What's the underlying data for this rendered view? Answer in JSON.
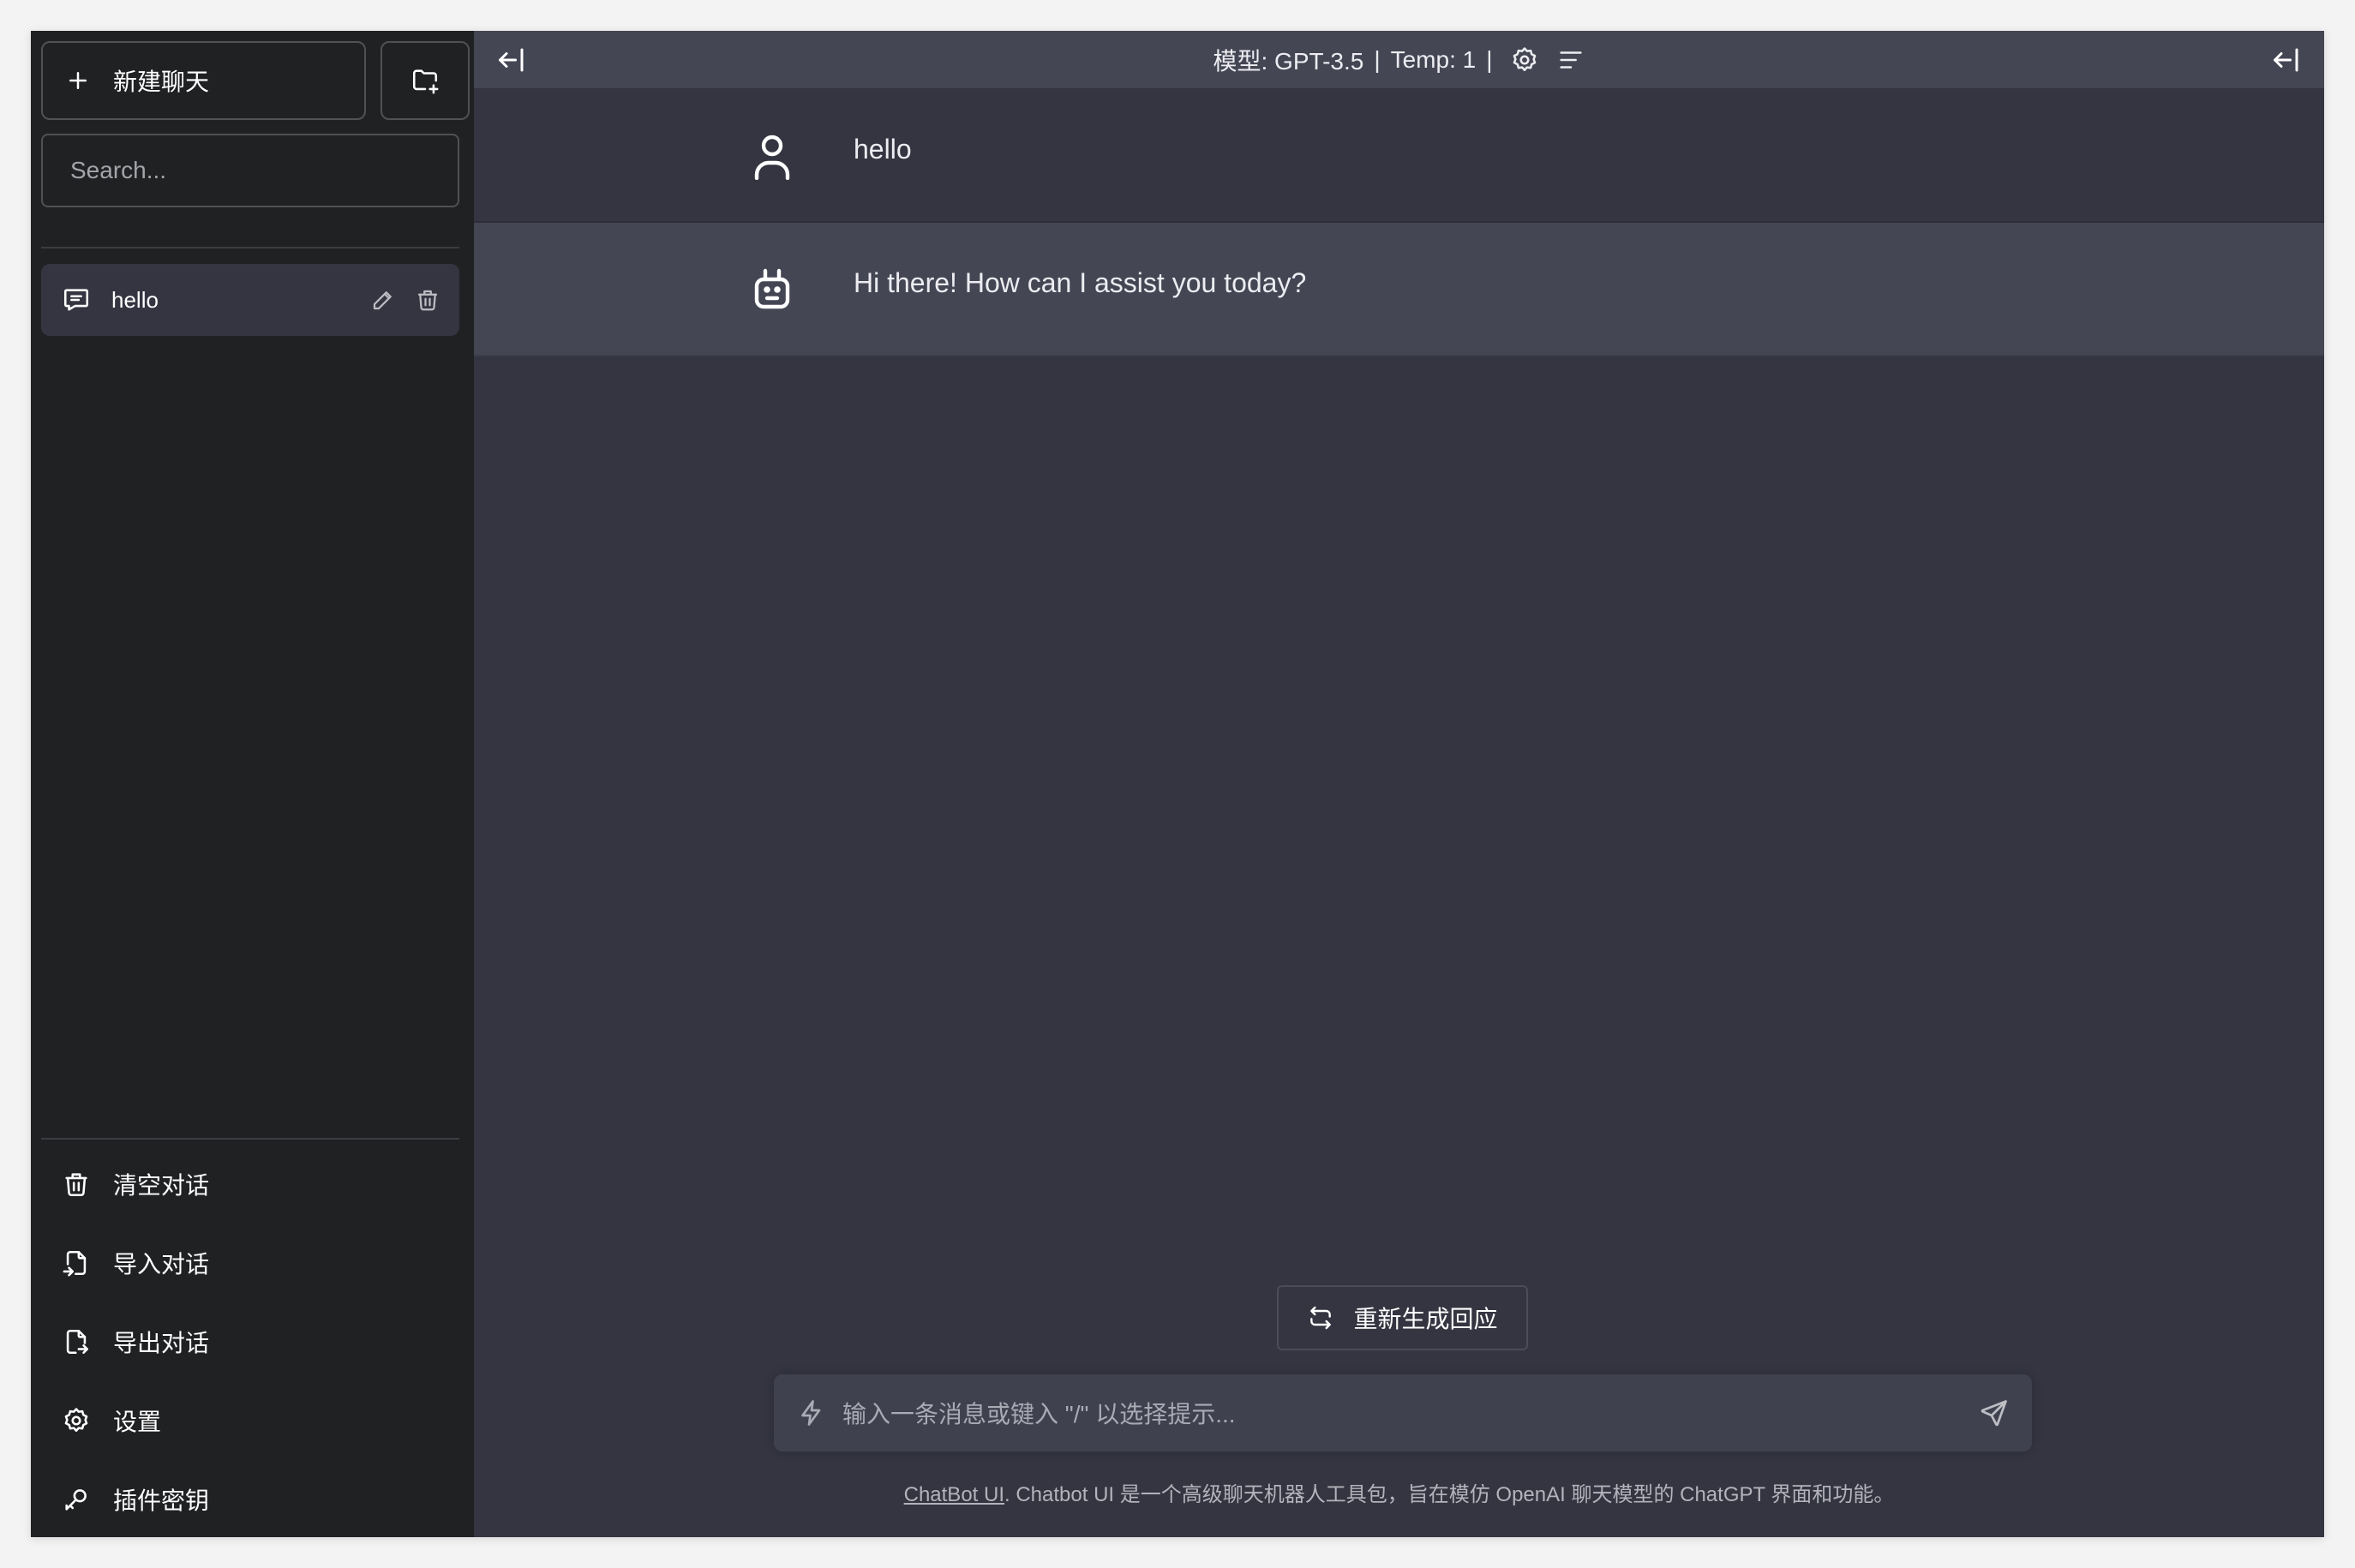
{
  "sidebar": {
    "new_chat_label": "新建聊天",
    "search_placeholder": "Search...",
    "conversations": [
      {
        "title": "hello"
      }
    ],
    "menu": [
      {
        "label": "清空对话",
        "icon": "trash-icon"
      },
      {
        "label": "导入对话",
        "icon": "file-import-icon"
      },
      {
        "label": "导出对话",
        "icon": "file-export-icon"
      },
      {
        "label": "设置",
        "icon": "settings-icon"
      },
      {
        "label": "插件密钥",
        "icon": "key-icon"
      }
    ]
  },
  "header": {
    "model_label": "模型: GPT-3.5",
    "separator": "|",
    "temp_label": "Temp: 1"
  },
  "messages": [
    {
      "role": "user",
      "text": "hello",
      "icon": "user-icon"
    },
    {
      "role": "assistant",
      "text": "Hi there! How can I assist you today?",
      "icon": "robot-icon"
    }
  ],
  "regenerate_label": "重新生成回应",
  "input": {
    "placeholder": "输入一条消息或键入 \"/\" 以选择提示..."
  },
  "footer": {
    "link_text": "ChatBot UI",
    "text": ". Chatbot UI 是一个高级聊天机器人工具包，旨在模仿 OpenAI 聊天模型的 ChatGPT 界面和功能。"
  },
  "colors": {
    "sidebar_bg": "#202123",
    "main_bg": "#343541",
    "assistant_row_bg": "#444654",
    "input_bg": "#40414f"
  }
}
